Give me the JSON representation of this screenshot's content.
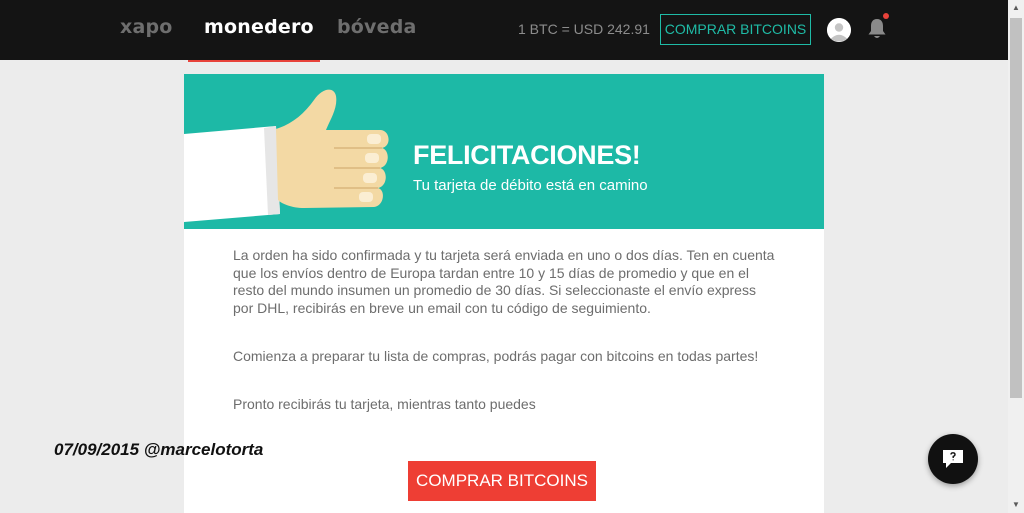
{
  "nav": {
    "links": [
      "xapo",
      "monedero",
      "bóveda"
    ],
    "active": "monedero",
    "rate": "1 BTC = USD 242.91",
    "buy_label": "COMPRAR BITCOINS"
  },
  "hero": {
    "title": "FELICITACIONES!",
    "subtitle": "Tu tarjeta de débito está en camino"
  },
  "body": {
    "p1": "La orden ha sido confirmada y tu tarjeta será enviada en uno o dos días. Ten en cuenta que los envíos dentro de Europa tardan entre 10 y 15 días de promedio y que en el resto del mundo insumen un promedio de 30 días. Si seleccionaste el envío express por DHL, recibirás en breve un email con tu código de seguimiento.",
    "p2": "Comienza a preparar tu lista de compras, podrás pagar con bitcoins en todas partes!",
    "p3": "Pronto recibirás tu tarjeta, mientras tanto puedes"
  },
  "cta": {
    "label": "COMPRAR BITCOINS"
  },
  "watermark": "07/09/2015 @marcelotorta",
  "colors": {
    "topbar": "#141414",
    "accent_teal": "#1db9a6",
    "cta_red": "#ee3e34",
    "active_underline": "#e8423a"
  },
  "icons": [
    "user-avatar-icon",
    "bell-icon",
    "chat-bubble-icon",
    "thumbs-up-illustration"
  ]
}
